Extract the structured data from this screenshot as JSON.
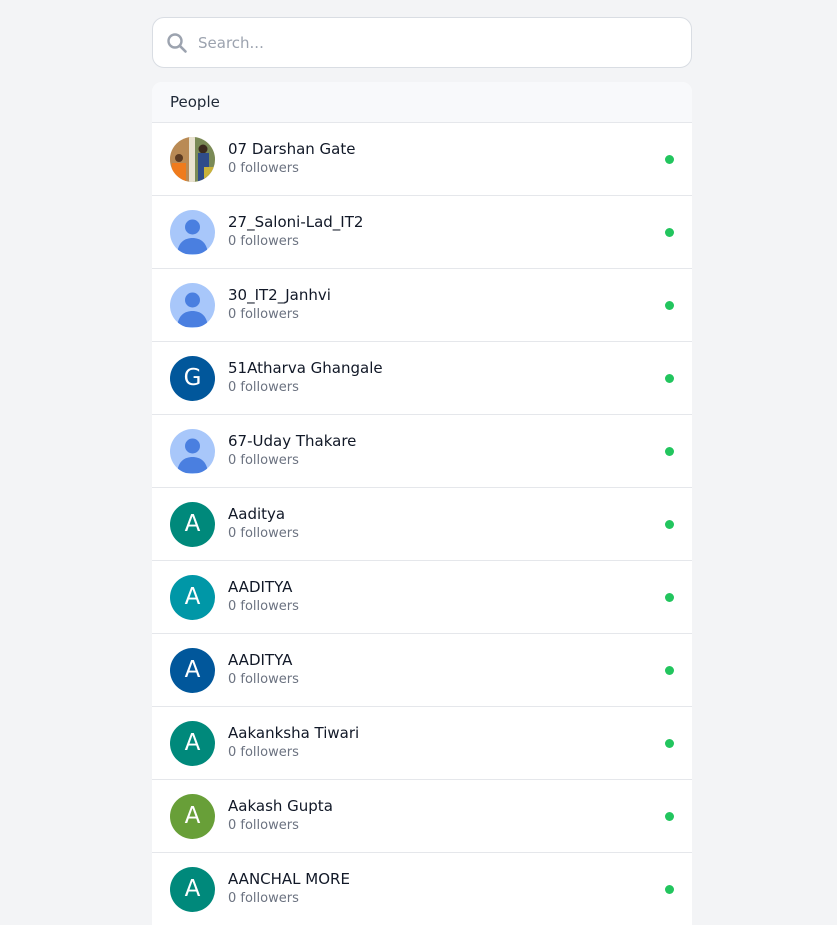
{
  "search": {
    "placeholder": "Search..."
  },
  "panel": {
    "title": "People"
  },
  "online_color": "#22c55e",
  "people": [
    {
      "name": "07 Darshan Gate",
      "followers": "0 followers",
      "avatar": "photo"
    },
    {
      "name": "27_Saloni-Lad_IT2",
      "followers": "0 followers",
      "avatar": "default-user-icon"
    },
    {
      "name": "30_IT2_Janhvi",
      "followers": "0 followers",
      "avatar": "default-user-icon"
    },
    {
      "name": "51Atharva Ghangale",
      "followers": "0 followers",
      "avatar": "letter",
      "letter": "G",
      "color": "#01579b"
    },
    {
      "name": "67-Uday Thakare",
      "followers": "0 followers",
      "avatar": "default-user-icon"
    },
    {
      "name": "Aaditya",
      "followers": "0 followers",
      "avatar": "letter",
      "letter": "A",
      "color": "#00897b"
    },
    {
      "name": "AADITYA",
      "followers": "0 followers",
      "avatar": "letter",
      "letter": "A",
      "color": "#0097a7"
    },
    {
      "name": "AADITYA",
      "followers": "0 followers",
      "avatar": "letter",
      "letter": "A",
      "color": "#01579b"
    },
    {
      "name": "Aakanksha Tiwari",
      "followers": "0 followers",
      "avatar": "letter",
      "letter": "A",
      "color": "#00897b"
    },
    {
      "name": "Aakash Gupta",
      "followers": "0 followers",
      "avatar": "letter",
      "letter": "A",
      "color": "#689f38"
    },
    {
      "name": "AANCHAL MORE",
      "followers": "0 followers",
      "avatar": "letter",
      "letter": "A",
      "color": "#00897b"
    }
  ]
}
